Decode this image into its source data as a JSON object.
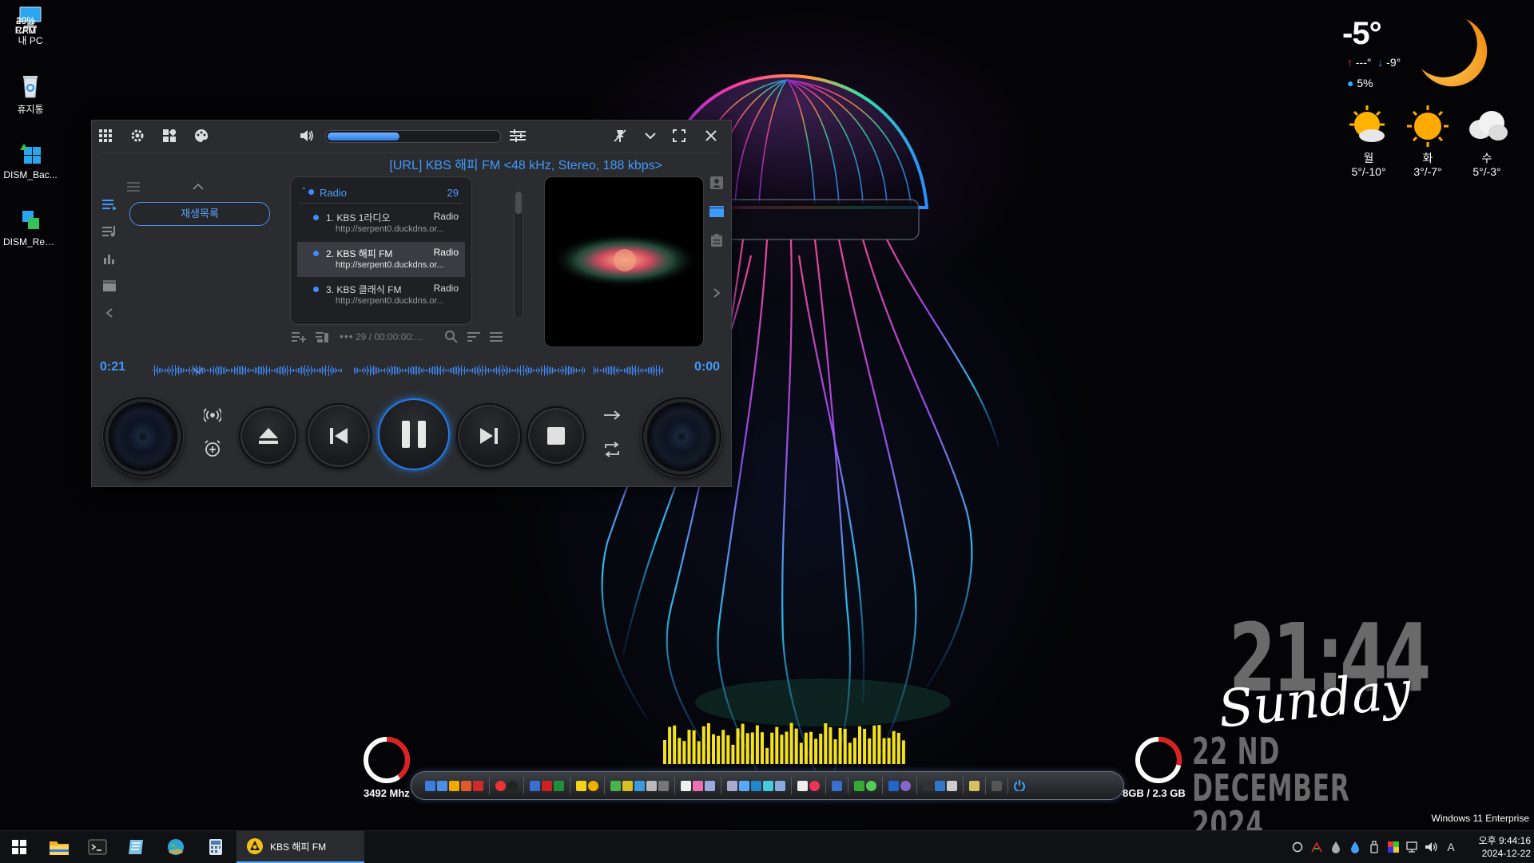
{
  "desktop": {
    "icons": [
      {
        "label": "내 PC",
        "icon": "pc-icon"
      },
      {
        "label": "휴지통",
        "icon": "recycle-bin-icon"
      },
      {
        "label": "DISM_Bac...",
        "icon": "dism-backup-icon"
      },
      {
        "label": "DISM_Rest...",
        "icon": "dism-restore-icon"
      }
    ]
  },
  "weather": {
    "current_temp": "-5°",
    "high": "---°",
    "low": "-9°",
    "humidity": "5%",
    "forecast": [
      {
        "day": "월",
        "range": "5°/-10°",
        "icon": "sun-cloud-icon"
      },
      {
        "day": "화",
        "range": "3°/-7°",
        "icon": "sun-icon"
      },
      {
        "day": "수",
        "range": "5°/-3°",
        "icon": "cloud-icon"
      }
    ],
    "colors": {
      "up": "#ff4040",
      "down": "#3fa0ff",
      "sun": "#ffb300",
      "moon": "#ff9a1f"
    }
  },
  "clock": {
    "time": "21:44",
    "day": "Sunday",
    "date": "22 ND DECEMBER 2024"
  },
  "monitor": {
    "cpu_percent": 40,
    "cpu_label": "40%",
    "cpu_name": "CPU",
    "cpu_freq": "3492 Mhz",
    "ram_percent": 29,
    "ram_label": "29%",
    "ram_name": "RAM",
    "ram_usage": "8GB /  2.3 GB",
    "colors": {
      "gauge": "#e02020",
      "track": "#ffffff"
    }
  },
  "player": {
    "now_playing": "[URL] KBS 해피 FM <48 kHz, Stereo, 188 kbps>",
    "volume_level": 0.42,
    "playlist_button": "재생목록",
    "list_header": "Radio",
    "list_count": "29",
    "items": [
      {
        "title": "1. KBS 1라디오",
        "url": "http://serpent0.duckdns.or...",
        "kind": "Radio",
        "selected": false
      },
      {
        "title": "2. KBS 해피 FM",
        "url": "http://serpent0.duckdns.or...",
        "kind": "Radio",
        "selected": true
      },
      {
        "title": "3. KBS 클래식 FM",
        "url": "http://serpent0.duckdns.or...",
        "kind": "Radio",
        "selected": false
      }
    ],
    "footer_info": "29 / 00:00:00:...",
    "time_elapsed": "0:21",
    "time_remaining": "0:00",
    "accent": "#3f9bff"
  },
  "taskbar": {
    "task_label": "KBS 해피 FM",
    "clock_time": "오후 9:44:16",
    "clock_date": "2024-12-22",
    "tray_lang": "A"
  },
  "os_watermark": "Windows 11 Enterprise"
}
